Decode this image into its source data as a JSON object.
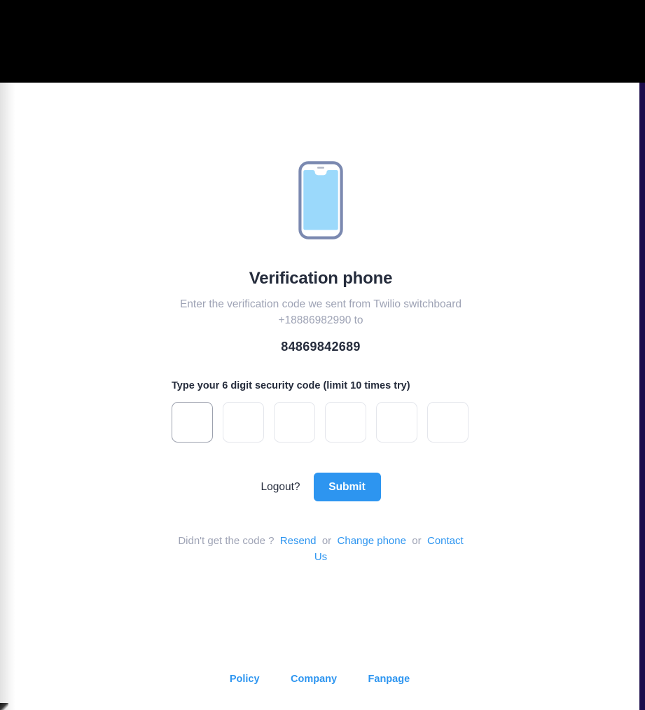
{
  "window": {
    "top_bar_color": "#000000",
    "right_edge_color": "#1b0c4c",
    "page_background": "#ffffff"
  },
  "illustration": {
    "icon_name": "mobile-phone-icon",
    "outline_color": "#7b89b0",
    "screen_color": "#9bd9fb"
  },
  "content": {
    "title": "Verification phone",
    "subtitle": "Enter the verification code we sent from Twilio switchboard +18886982990 to",
    "phone_number": "84869842689",
    "otp_label": "Type your 6 digit security code (limit 10 times try)",
    "title_color": "#252c3c",
    "subtitle_color": "#9ea3b5"
  },
  "otp": {
    "count": 6,
    "values": [
      "",
      "",
      "",
      "",
      "",
      ""
    ],
    "focused_index": 0,
    "focused_border_color": "#9ca1ae",
    "idle_border_color": "#e4e6ec"
  },
  "actions": {
    "logout_label": "Logout?",
    "submit_label": "Submit",
    "submit_color": "#2d95f0"
  },
  "resend": {
    "prompt": "Didn't get the code ?",
    "resend_label": "Resend",
    "separator_1": "or",
    "change_phone_label": "Change phone",
    "separator_2": "or",
    "contact_label": "Contact Us",
    "link_color": "#2d95f0"
  },
  "footer": {
    "links": [
      {
        "label": "Policy"
      },
      {
        "label": "Company"
      },
      {
        "label": "Fanpage"
      }
    ],
    "link_color": "#2d95f0"
  }
}
